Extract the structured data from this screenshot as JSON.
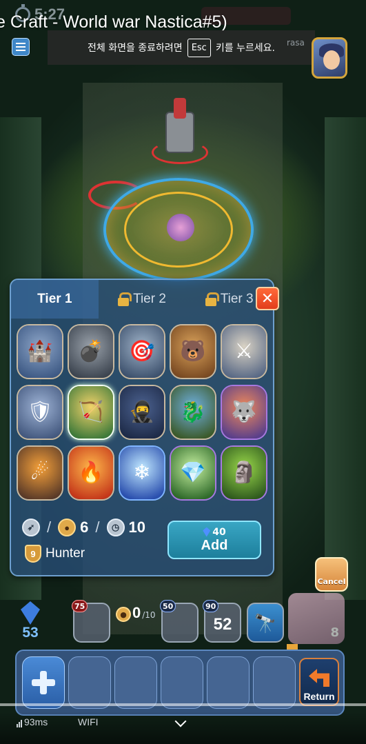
{
  "video": {
    "title": "e Craft - World war Nastica#5)",
    "fullscreen_toast": {
      "before": "전체 화면을 종료하려면",
      "key": "Esc",
      "after": "키를 누르세요."
    }
  },
  "top_bar": {
    "timer": "5:27",
    "opponent_name": "rasa"
  },
  "panel": {
    "tabs": [
      {
        "label": "Tier 1",
        "locked": false
      },
      {
        "label": "Tier 2",
        "locked": true
      },
      {
        "label": "Tier 3",
        "locked": true
      }
    ],
    "close_label": "✕",
    "units": [
      {
        "name": "archer-tower",
        "glyph": "🏰",
        "frame": "bronze",
        "c1": "#8ea6c8",
        "c2": "#3e5a85"
      },
      {
        "name": "cannon",
        "glyph": "💣",
        "frame": "bronze",
        "c1": "#9aa2ab",
        "c2": "#3d4550"
      },
      {
        "name": "ballista",
        "glyph": "🎯",
        "frame": "bronze",
        "c1": "#a0b3c8",
        "c2": "#3e526e"
      },
      {
        "name": "bear-warrior",
        "glyph": "🐻",
        "frame": "bronze",
        "c1": "#d8a15a",
        "c2": "#7a4a22"
      },
      {
        "name": "knight",
        "glyph": "⚔",
        "frame": "bronze",
        "c1": "#d9d2c4",
        "c2": "#5a6a86"
      },
      {
        "name": "soldier",
        "glyph": "🛡",
        "frame": "bronze",
        "c1": "#9fb4d6",
        "c2": "#44597f"
      },
      {
        "name": "ranger",
        "glyph": "🏹",
        "frame": "selected",
        "c1": "#f2d36a",
        "c2": "#3f7a3a"
      },
      {
        "name": "ninja",
        "glyph": "🥷",
        "frame": "bronze",
        "c1": "#4c6290",
        "c2": "#1e2b48"
      },
      {
        "name": "dragon-rider",
        "glyph": "🐉",
        "frame": "bronze",
        "c1": "#6fb0e0",
        "c2": "#3c5a2a"
      },
      {
        "name": "wolf-girl",
        "glyph": "🐺",
        "frame": "purple",
        "c1": "#f08a5a",
        "c2": "#5a3f8a"
      },
      {
        "name": "meteor-spell",
        "glyph": "☄",
        "frame": "bronze",
        "c1": "#f4a03a",
        "c2": "#5a3a28"
      },
      {
        "name": "fire-slash-spell",
        "glyph": "🔥",
        "frame": "bronze",
        "c1": "#ffb84a",
        "c2": "#c4361a"
      },
      {
        "name": "ice-spell",
        "glyph": "❄",
        "frame": "blue",
        "c1": "#bfe7ff",
        "c2": "#2a4fae"
      },
      {
        "name": "nature-crystal-spell",
        "glyph": "💎",
        "frame": "purple",
        "c1": "#c6f0a0",
        "c2": "#2f6a2a"
      },
      {
        "name": "totem-spell",
        "glyph": "🗿",
        "frame": "purple",
        "c1": "#9ad84a",
        "c2": "#2f5a1e"
      }
    ],
    "stats": {
      "speed_value": "",
      "population": "6",
      "cooldown": "10",
      "class_level": "9",
      "class_name": "Hunter"
    },
    "add_button": {
      "cost": "40",
      "label": "Add"
    }
  },
  "hud": {
    "cancel_label": "Cancel",
    "mana": "53",
    "slots": [
      {
        "badge": "75",
        "value": "",
        "badge_style": "red"
      },
      {
        "badge": "50",
        "value": "",
        "badge_style": "normal"
      },
      {
        "badge": "90",
        "value": "52",
        "badge_style": "normal"
      },
      {
        "badge": "",
        "value": "",
        "badge_style": "normal"
      }
    ],
    "population": {
      "current": "0",
      "max": "/10"
    },
    "hero_level": "8",
    "return_label": "Return"
  },
  "status": {
    "ping": "93ms",
    "network": "WIFI"
  }
}
